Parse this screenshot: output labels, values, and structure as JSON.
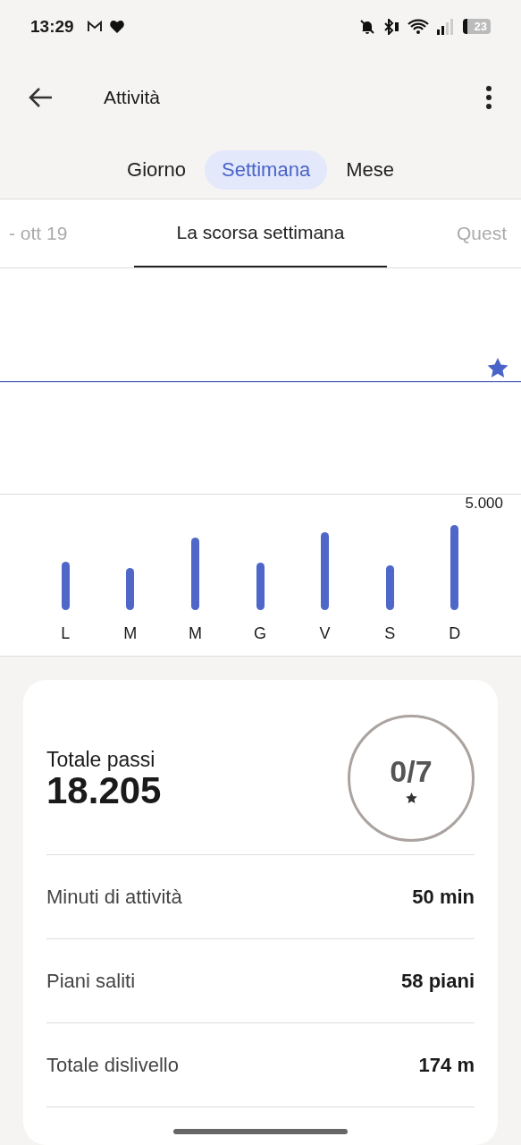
{
  "status_bar": {
    "time": "13:29",
    "battery": "23"
  },
  "header": {
    "title": "Attività"
  },
  "range_tabs": [
    {
      "label": "Giorno",
      "selected": false
    },
    {
      "label": "Settimana",
      "selected": true
    },
    {
      "label": "Mese",
      "selected": false
    }
  ],
  "period_tabs": [
    {
      "label": "- ott 19",
      "selected": false
    },
    {
      "label": "La scorsa settimana",
      "selected": true
    },
    {
      "label": "Quest",
      "selected": false
    }
  ],
  "chart": {
    "goal_label": "5.000",
    "days": [
      "L",
      "M",
      "M",
      "G",
      "V",
      "S",
      "D"
    ]
  },
  "summary": {
    "label": "Totale passi",
    "value": "18.205",
    "goal_days": "0/7"
  },
  "stats": [
    {
      "label": "Minuti di attività",
      "value": "50 min"
    },
    {
      "label": "Piani saliti",
      "value": "58 piani"
    },
    {
      "label": "Totale dislivello",
      "value": "174 m"
    }
  ]
}
